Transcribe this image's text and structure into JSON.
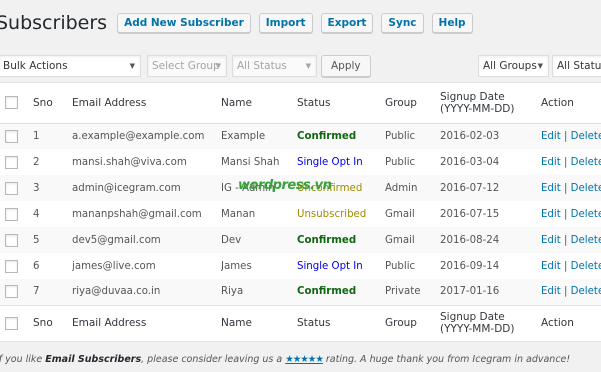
{
  "page": {
    "title": "Subscribers",
    "buttons": [
      "Add New Subscriber",
      "Import",
      "Export",
      "Sync",
      "Help"
    ]
  },
  "toolbar": {
    "bulk_actions": "Bulk Actions",
    "select_group": "Select Group",
    "all_status": "All Status",
    "apply": "Apply",
    "all_groups": "All Groups",
    "all_status_right": "All Status"
  },
  "table": {
    "headers": {
      "sno": "Sno",
      "email": "Email Address",
      "name": "Name",
      "status": "Status",
      "group": "Group",
      "signup_line1": "Signup Date",
      "signup_line2": "(YYYY-MM-DD)",
      "action": "Action"
    },
    "rows": [
      {
        "sno": "1",
        "email": "a.example@example.com",
        "name": "Example",
        "status": "Confirmed",
        "group": "Public",
        "date": "2016-02-03",
        "edit": "Edit",
        "sep": "|",
        "delete": "Delete"
      },
      {
        "sno": "2",
        "email": "mansi.shah@viva.com",
        "name": "Mansi Shah",
        "status": "Single Opt In",
        "group": "Public",
        "date": "2016-03-04",
        "edit": "Edit",
        "sep": "|",
        "delete": "Delete"
      },
      {
        "sno": "3",
        "email": "admin@icegram.com",
        "name": "IG - Admin",
        "status": "Unconfirmed",
        "group": "Admin",
        "date": "2016-07-12",
        "edit": "Edit",
        "sep": "|",
        "delete": "Delete |"
      },
      {
        "sno": "4",
        "email": "mananpshah@gmail.com",
        "name": "Manan",
        "status": "Unsubscribed",
        "group": "Gmail",
        "date": "2016-07-15",
        "edit": "Edit",
        "sep": "|",
        "delete": "Delete"
      },
      {
        "sno": "5",
        "email": "dev5@gmail.com",
        "name": "Dev",
        "status": "Confirmed",
        "group": "Gmail",
        "date": "2016-08-24",
        "edit": "Edit",
        "sep": "|",
        "delete": "Delete"
      },
      {
        "sno": "6",
        "email": "james@live.com",
        "name": "James",
        "status": "Single Opt In",
        "group": "Public",
        "date": "2016-09-14",
        "edit": "Edit",
        "sep": "|",
        "delete": "Delete"
      },
      {
        "sno": "7",
        "email": "riya@duvaa.co.in",
        "name": "Riya",
        "status": "Confirmed",
        "group": "Private",
        "date": "2017-01-16",
        "edit": "Edit",
        "sep": "|",
        "delete": "Delete"
      }
    ]
  },
  "footer": {
    "prefix": "If you like ",
    "plugin": "Email Subscribers",
    "middle": ", please consider leaving us a ",
    "stars": "★★★★★",
    "suffix": " rating. A huge thank you from Icegram in advance!"
  },
  "watermark": "wordpress.vn"
}
